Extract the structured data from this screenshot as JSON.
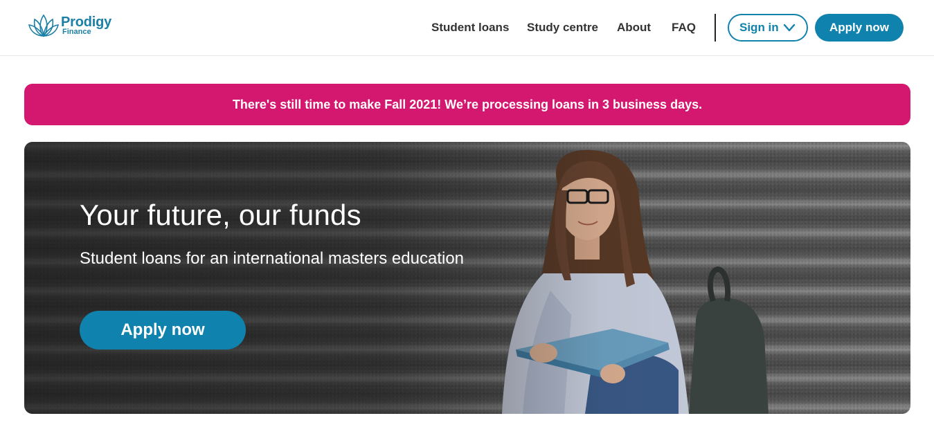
{
  "brand": {
    "name": "Prodigy",
    "sub": "Finance",
    "accent": "#0f82ad",
    "banner_color": "#d4186f"
  },
  "nav": {
    "items": [
      {
        "label": "Student loans"
      },
      {
        "label": "Study centre"
      },
      {
        "label": "About"
      },
      {
        "label": "FAQ"
      }
    ],
    "signin_label": "Sign in",
    "apply_label": "Apply now"
  },
  "banner": {
    "text": "There's still time to make Fall 2021! We’re processing loans in 3 business days."
  },
  "hero": {
    "title": "Your future, our funds",
    "subtitle": "Student loans for an international masters education",
    "cta_label": "Apply now",
    "image": "student-with-book-on-steps"
  },
  "icons": {
    "logo": "lotus-logo-icon",
    "signin_dropdown": "chevron-down-icon"
  }
}
